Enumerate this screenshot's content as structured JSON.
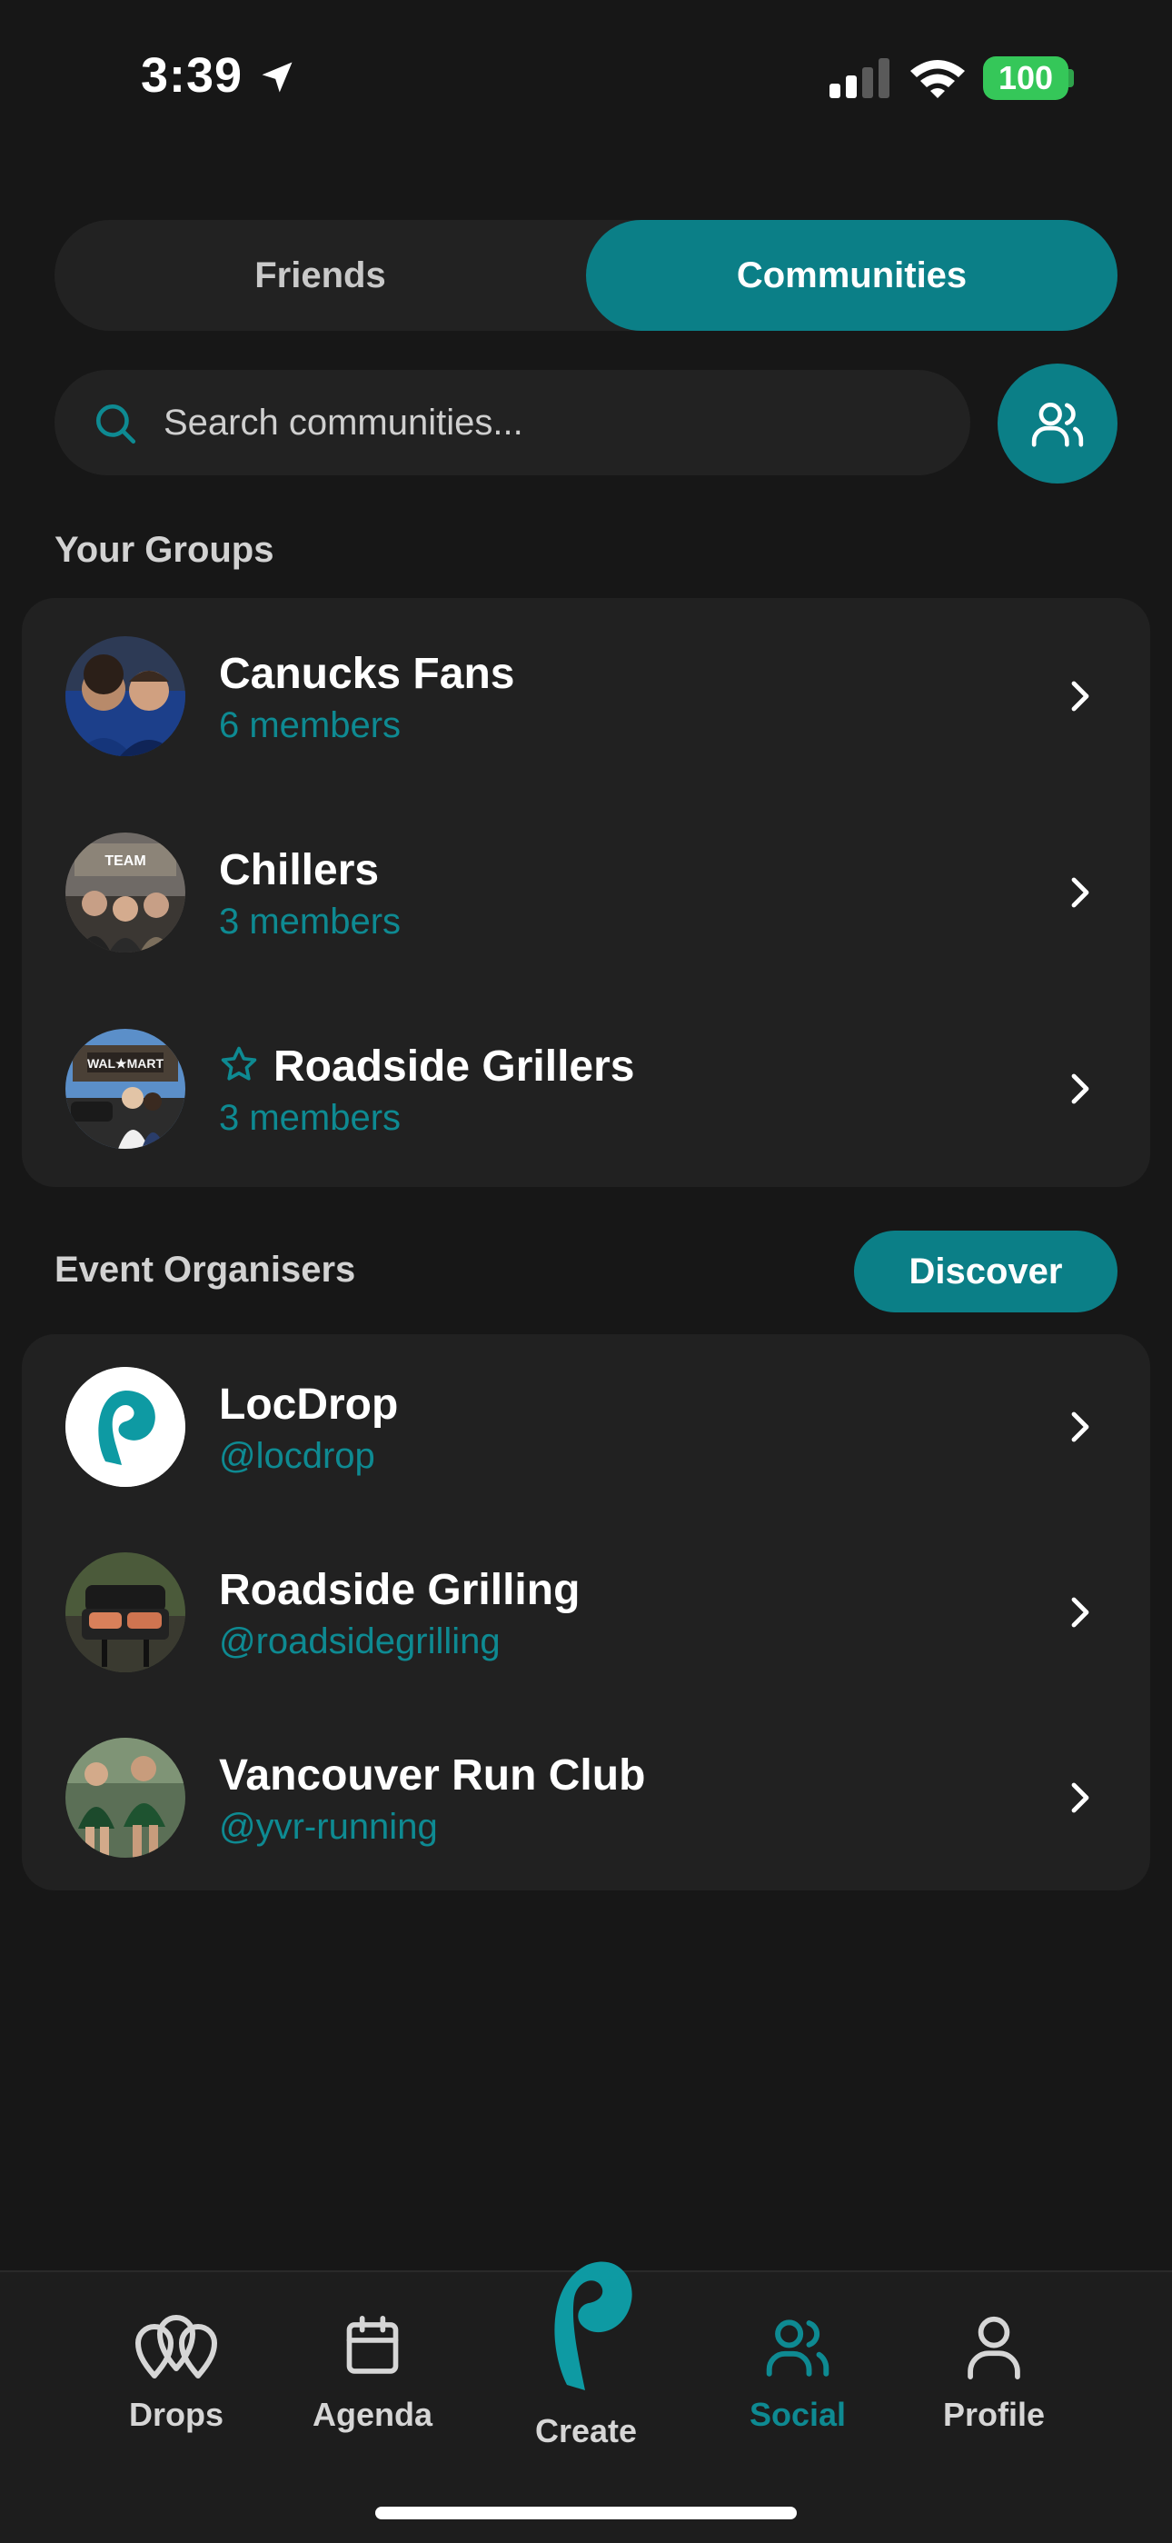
{
  "status_bar": {
    "time": "3:39",
    "battery": "100"
  },
  "segmented": {
    "friends": "Friends",
    "communities": "Communities",
    "active": "Communities"
  },
  "search": {
    "placeholder": "Search communities..."
  },
  "your_groups": {
    "title": "Your Groups",
    "items": [
      {
        "name": "Canucks Fans",
        "subtitle": "6 members",
        "starred": false,
        "avatar": "group-photo-avatar"
      },
      {
        "name": "Chillers",
        "subtitle": "3 members",
        "starred": false,
        "avatar": "group-photo-avatar"
      },
      {
        "name": "Roadside Grillers",
        "subtitle": "3 members",
        "starred": true,
        "avatar": "group-photo-avatar"
      }
    ]
  },
  "event_organisers": {
    "title": "Event Organisers",
    "discover_label": "Discover",
    "items": [
      {
        "name": "LocDrop",
        "handle": "@locdrop",
        "avatar": "locdrop-logo"
      },
      {
        "name": "Roadside Grilling",
        "handle": "@roadsidegrilling",
        "avatar": "grill-photo-avatar"
      },
      {
        "name": "Vancouver Run Club",
        "handle": "@yvr-running",
        "avatar": "runners-photo-avatar"
      }
    ]
  },
  "tabbar": {
    "items": [
      {
        "label": "Drops",
        "icon": "drops-pins-icon"
      },
      {
        "label": "Agenda",
        "icon": "calendar-icon"
      },
      {
        "label": "Create",
        "icon": "locdrop-pin-icon"
      },
      {
        "label": "Social",
        "icon": "people-icon"
      },
      {
        "label": "Profile",
        "icon": "person-icon"
      }
    ],
    "active": "Social"
  },
  "colors": {
    "accent": "#0b7f87",
    "accent_text": "#0e8a92",
    "background": "#171717",
    "card": "#212121",
    "battery": "#35c759"
  }
}
